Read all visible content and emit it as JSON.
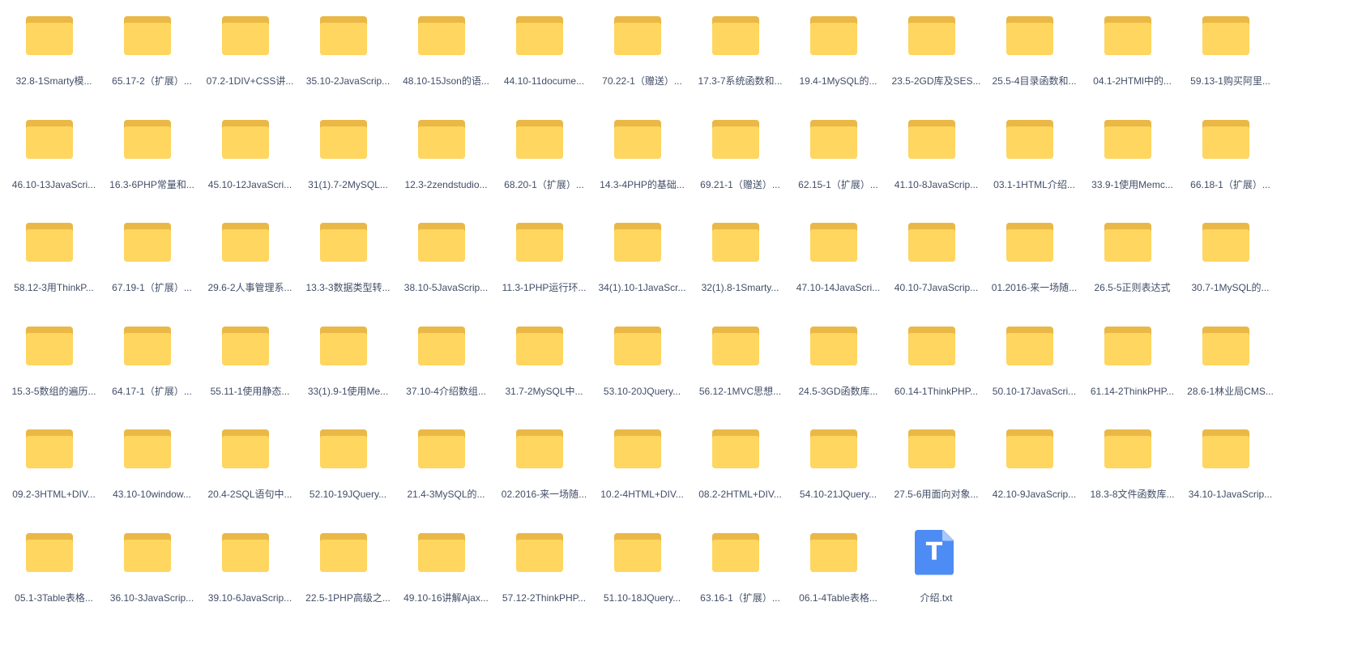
{
  "icons": {
    "folder": "folder-icon",
    "text_file": "text-file-icon",
    "text_file_glyph": "T"
  },
  "colors": {
    "folder_front": "#ffd65f",
    "folder_back": "#eab847",
    "text_file": "#4d8cf5",
    "label_text": "#424e67"
  },
  "files": [
    {
      "name": "32.8-1Smarty模...",
      "type": "folder"
    },
    {
      "name": "65.17-2（扩展）...",
      "type": "folder"
    },
    {
      "name": "07.2-1DIV+CSS讲...",
      "type": "folder"
    },
    {
      "name": "35.10-2JavaScrip...",
      "type": "folder"
    },
    {
      "name": "48.10-15Json的语...",
      "type": "folder"
    },
    {
      "name": "44.10-11docume...",
      "type": "folder"
    },
    {
      "name": "70.22-1（赠送）...",
      "type": "folder"
    },
    {
      "name": "17.3-7系统函数和...",
      "type": "folder"
    },
    {
      "name": "19.4-1MySQL的...",
      "type": "folder"
    },
    {
      "name": "23.5-2GD库及SES...",
      "type": "folder"
    },
    {
      "name": "25.5-4目录函数和...",
      "type": "folder"
    },
    {
      "name": "04.1-2HTMl中的...",
      "type": "folder"
    },
    {
      "name": "59.13-1购买阿里...",
      "type": "folder"
    },
    {
      "name": "46.10-13JavaScri...",
      "type": "folder"
    },
    {
      "name": "16.3-6PHP常量和...",
      "type": "folder"
    },
    {
      "name": "45.10-12JavaScri...",
      "type": "folder"
    },
    {
      "name": "31(1).7-2MySQL...",
      "type": "folder"
    },
    {
      "name": "12.3-2zendstudio...",
      "type": "folder"
    },
    {
      "name": "68.20-1（扩展）...",
      "type": "folder"
    },
    {
      "name": "14.3-4PHP的基础...",
      "type": "folder"
    },
    {
      "name": "69.21-1（赠送）...",
      "type": "folder"
    },
    {
      "name": "62.15-1（扩展）...",
      "type": "folder"
    },
    {
      "name": "41.10-8JavaScrip...",
      "type": "folder"
    },
    {
      "name": "03.1-1HTML介绍...",
      "type": "folder"
    },
    {
      "name": "33.9-1使用Memc...",
      "type": "folder"
    },
    {
      "name": "66.18-1（扩展）...",
      "type": "folder"
    },
    {
      "name": "58.12-3用ThinkP...",
      "type": "folder"
    },
    {
      "name": "67.19-1（扩展）...",
      "type": "folder"
    },
    {
      "name": "29.6-2人事管理系...",
      "type": "folder"
    },
    {
      "name": "13.3-3数据类型转...",
      "type": "folder"
    },
    {
      "name": "38.10-5JavaScrip...",
      "type": "folder"
    },
    {
      "name": "11.3-1PHP运行环...",
      "type": "folder"
    },
    {
      "name": "34(1).10-1JavaScr...",
      "type": "folder"
    },
    {
      "name": "32(1).8-1Smarty...",
      "type": "folder"
    },
    {
      "name": "47.10-14JavaScri...",
      "type": "folder"
    },
    {
      "name": "40.10-7JavaScrip...",
      "type": "folder"
    },
    {
      "name": "01.2016-来一场随...",
      "type": "folder"
    },
    {
      "name": "26.5-5正则表达式",
      "type": "folder"
    },
    {
      "name": "30.7-1MySQL的...",
      "type": "folder"
    },
    {
      "name": "15.3-5数组的遍历...",
      "type": "folder"
    },
    {
      "name": "64.17-1（扩展）...",
      "type": "folder"
    },
    {
      "name": "55.11-1使用静态...",
      "type": "folder"
    },
    {
      "name": "33(1).9-1使用Me...",
      "type": "folder"
    },
    {
      "name": "37.10-4介绍数组...",
      "type": "folder"
    },
    {
      "name": "31.7-2MySQL中...",
      "type": "folder"
    },
    {
      "name": "53.10-20JQuery...",
      "type": "folder"
    },
    {
      "name": "56.12-1MVC思想...",
      "type": "folder"
    },
    {
      "name": "24.5-3GD函数库...",
      "type": "folder"
    },
    {
      "name": "60.14-1ThinkPHP...",
      "type": "folder"
    },
    {
      "name": "50.10-17JavaScri...",
      "type": "folder"
    },
    {
      "name": "61.14-2ThinkPHP...",
      "type": "folder"
    },
    {
      "name": "28.6-1林业局CMS...",
      "type": "folder"
    },
    {
      "name": "09.2-3HTML+DIV...",
      "type": "folder"
    },
    {
      "name": "43.10-10window...",
      "type": "folder"
    },
    {
      "name": "20.4-2SQL语句中...",
      "type": "folder"
    },
    {
      "name": "52.10-19JQuery...",
      "type": "folder"
    },
    {
      "name": "21.4-3MySQL的...",
      "type": "folder"
    },
    {
      "name": "02.2016-来一场随...",
      "type": "folder"
    },
    {
      "name": "10.2-4HTML+DIV...",
      "type": "folder"
    },
    {
      "name": "08.2-2HTML+DIV...",
      "type": "folder"
    },
    {
      "name": "54.10-21JQuery...",
      "type": "folder"
    },
    {
      "name": "27.5-6用面向对象...",
      "type": "folder"
    },
    {
      "name": "42.10-9JavaScrip...",
      "type": "folder"
    },
    {
      "name": "18.3-8文件函数库...",
      "type": "folder"
    },
    {
      "name": "34.10-1JavaScrip...",
      "type": "folder"
    },
    {
      "name": "05.1-3Table表格...",
      "type": "folder"
    },
    {
      "name": "36.10-3JavaScrip...",
      "type": "folder"
    },
    {
      "name": "39.10-6JavaScrip...",
      "type": "folder"
    },
    {
      "name": "22.5-1PHP高级之...",
      "type": "folder"
    },
    {
      "name": "49.10-16讲解Ajax...",
      "type": "folder"
    },
    {
      "name": "57.12-2ThinkPHP...",
      "type": "folder"
    },
    {
      "name": "51.10-18JQuery...",
      "type": "folder"
    },
    {
      "name": "63.16-1（扩展）...",
      "type": "folder"
    },
    {
      "name": "06.1-4Table表格...",
      "type": "folder"
    },
    {
      "name": "介绍.txt",
      "type": "txt"
    }
  ]
}
